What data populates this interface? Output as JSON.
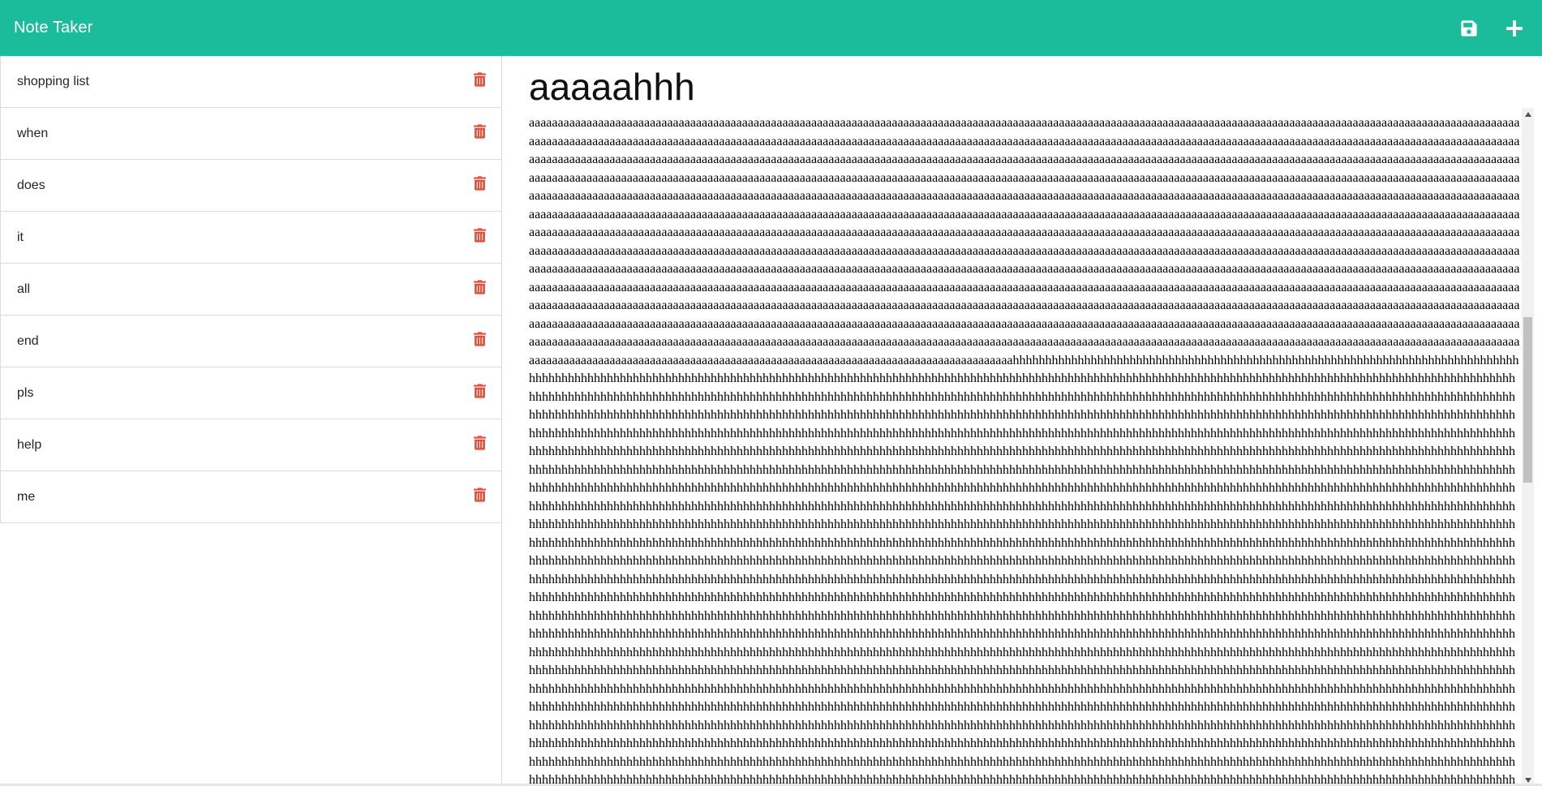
{
  "app": {
    "title": "Note Taker"
  },
  "nav": {
    "save_icon": "save-icon",
    "new_icon": "plus-icon",
    "bg_color": "#1abc9c"
  },
  "notes": [
    {
      "title": "shopping list"
    },
    {
      "title": "when"
    },
    {
      "title": "does"
    },
    {
      "title": "it"
    },
    {
      "title": "all"
    },
    {
      "title": "end"
    },
    {
      "title": "pls"
    },
    {
      "title": "help"
    },
    {
      "title": "me"
    }
  ],
  "active_note": {
    "title": "aaaaahhh",
    "a_count": 2320,
    "h_count": 4000
  },
  "colors": {
    "delete": "#e74c3c",
    "accent": "#1abc9c"
  }
}
